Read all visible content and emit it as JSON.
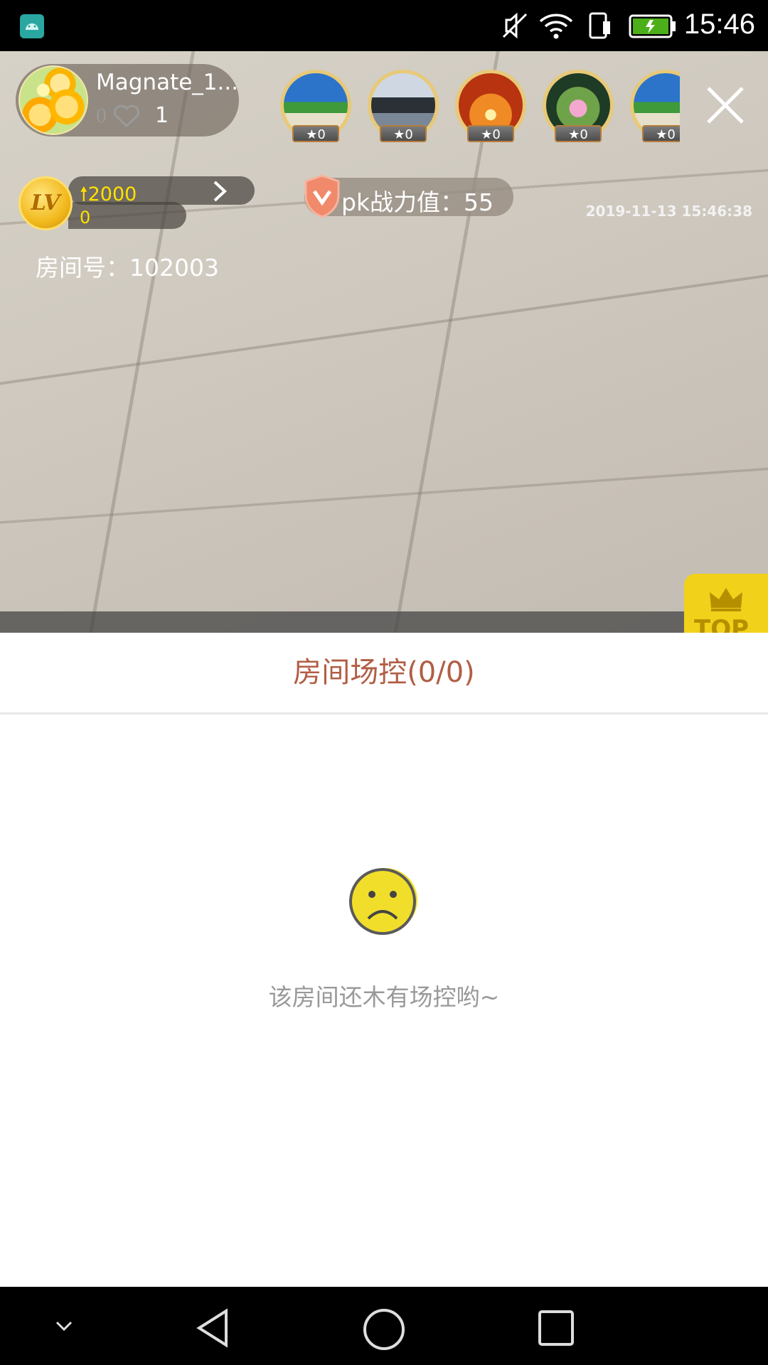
{
  "status_bar": {
    "time": "15:46",
    "icons": [
      "android-debug-icon",
      "mute-icon",
      "wifi-icon",
      "sim-icon",
      "battery-charging-icon"
    ]
  },
  "live": {
    "host": {
      "name": "Magnate_1...",
      "zero_count": "0",
      "likes": "1"
    },
    "viewers": [
      {
        "badge": "0"
      },
      {
        "badge": "0"
      },
      {
        "badge": "0"
      },
      {
        "badge": "0"
      },
      {
        "badge": "0"
      }
    ],
    "level": {
      "coin_label": "LV",
      "up_value": "2000",
      "current": "0"
    },
    "room_number_label": "房间号：102003",
    "pk_label": "pk战力值：55",
    "timestamp": "2019-11-13 15:46:38",
    "top_tab_label": "TOP"
  },
  "sheet": {
    "title": "房间场控(0/0)",
    "empty_message": "该房间还木有场控哟~"
  },
  "navigation": {
    "buttons": [
      "collapse-icon",
      "back-icon",
      "home-icon",
      "recents-icon"
    ]
  },
  "colors": {
    "accent_title": "#b15e44",
    "level_text": "#ffe100",
    "top_tab": "#f2d11a"
  }
}
